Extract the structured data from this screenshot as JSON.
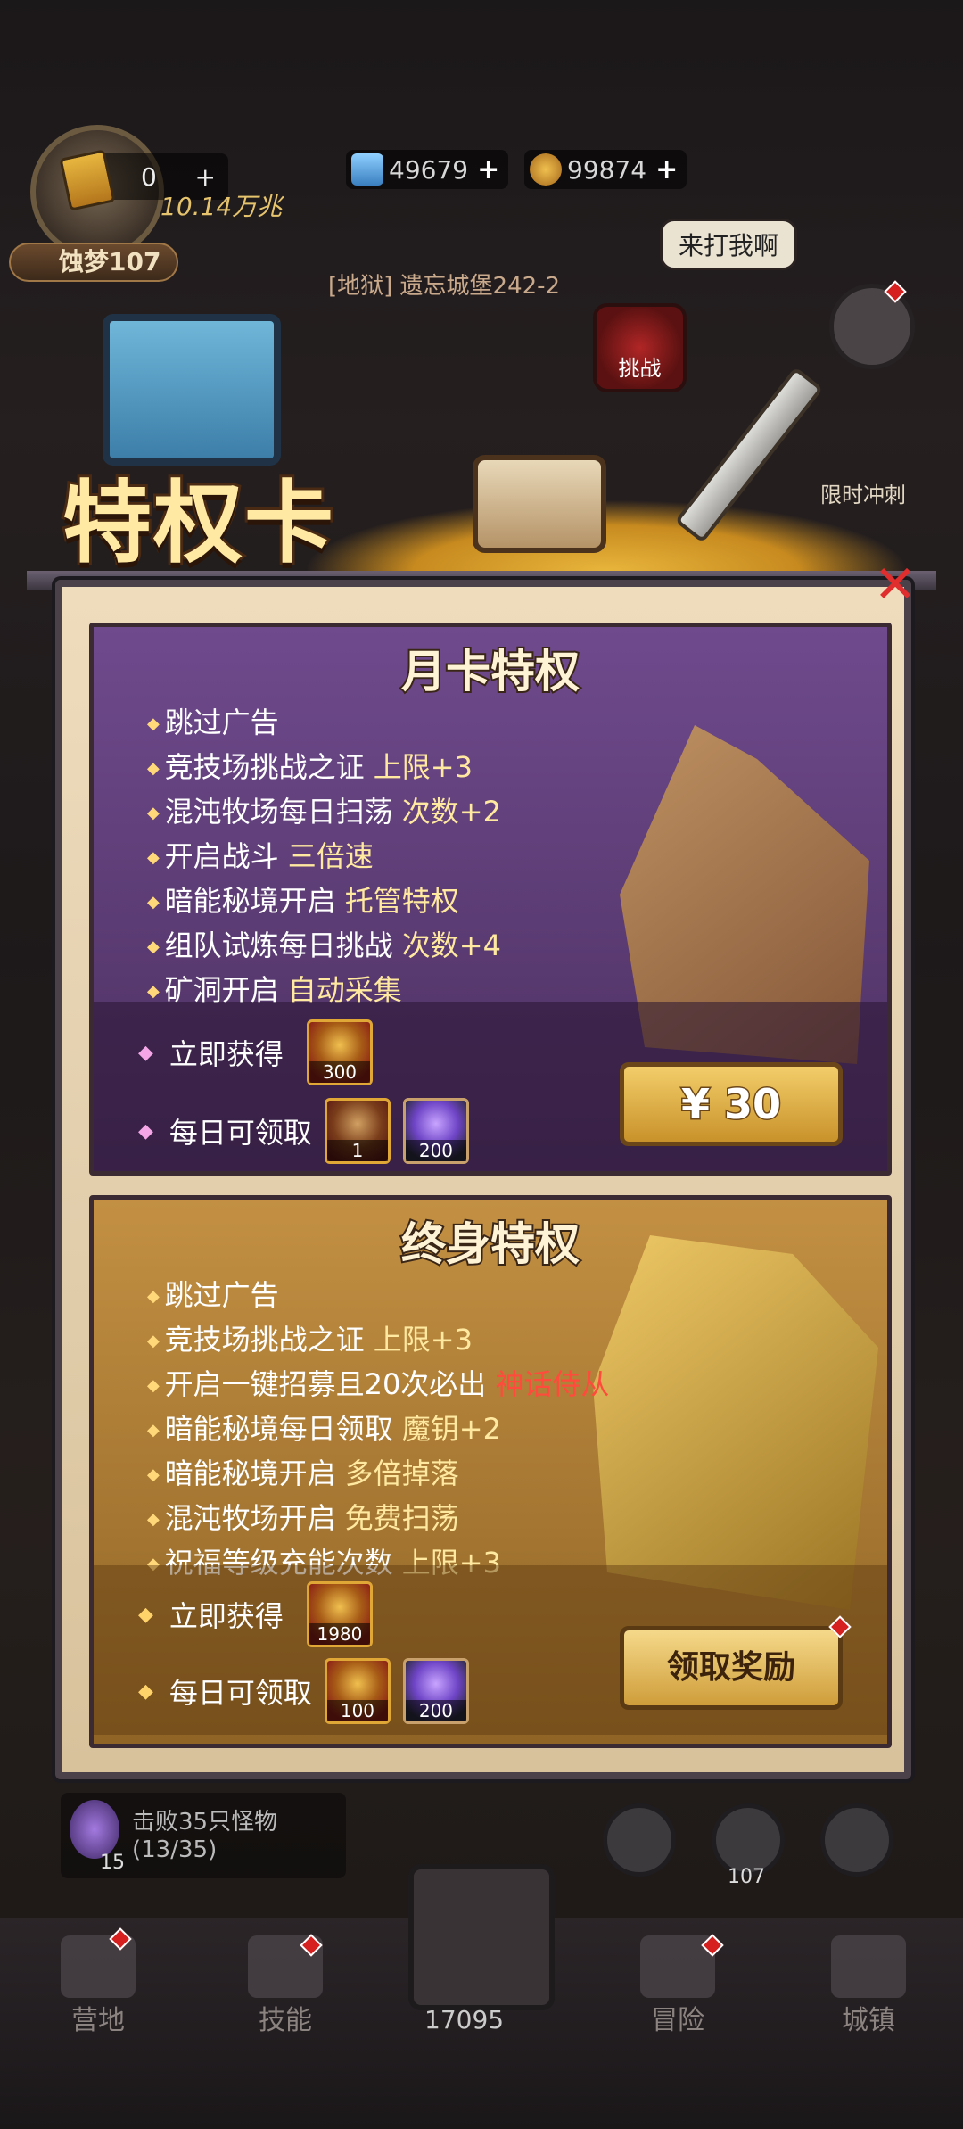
{
  "hud": {
    "ticket_count": "0",
    "power": "10.14万兆",
    "dream_badge": "蚀梦107",
    "diamonds": "49679",
    "gold": "99874",
    "speech": "来打我啊",
    "stage": "[地狱] 遗忘城堡242-2",
    "challenge_label": "挑战",
    "timed_label": "限时冲刺"
  },
  "banner": {
    "title": "特权卡"
  },
  "monthly": {
    "title": "月卡特权",
    "perks": [
      {
        "text": "跳过广告",
        "hl": ""
      },
      {
        "text": "竞技场挑战之证 ",
        "hl": "上限+3"
      },
      {
        "text": "混沌牧场每日扫荡 ",
        "hl": "次数+2"
      },
      {
        "text": "开启战斗 ",
        "hl": "三倍速"
      },
      {
        "text": "暗能秘境开启 ",
        "hl": "托管特权"
      },
      {
        "text": "组队试炼每日挑战 ",
        "hl": "次数+4"
      },
      {
        "text": "矿洞开启 ",
        "hl": "自动采集"
      }
    ],
    "instant_label": "立即获得",
    "instant_items": [
      {
        "icon": "gold-skull-coin-icon",
        "count": "300"
      }
    ],
    "daily_label": "每日可领取",
    "daily_items": [
      {
        "icon": "axe-icon",
        "count": "1"
      },
      {
        "icon": "purple-flame-icon",
        "count": "200"
      }
    ],
    "price": "¥ 30"
  },
  "lifetime": {
    "title": "终身特权",
    "perks": [
      {
        "text": "跳过广告",
        "hl": "",
        "red": ""
      },
      {
        "text": "竞技场挑战之证 ",
        "hl": "上限+3",
        "red": ""
      },
      {
        "text": "开启一键招募且20次必出 ",
        "hl": "",
        "red": "神话侍从"
      },
      {
        "text": "暗能秘境每日领取 ",
        "hl": "魔钥+2",
        "red": ""
      },
      {
        "text": "暗能秘境开启 ",
        "hl": "多倍掉落",
        "red": ""
      },
      {
        "text": "混沌牧场开启 ",
        "hl": "免费扫荡",
        "red": ""
      },
      {
        "text": "祝福等级充能次数 ",
        "hl": "上限+3",
        "red": ""
      }
    ],
    "instant_label": "立即获得",
    "instant_items": [
      {
        "icon": "gold-skull-coin-icon",
        "count": "1980"
      }
    ],
    "daily_label": "每日可领取",
    "daily_items": [
      {
        "icon": "gold-skull-coin-icon",
        "count": "100"
      },
      {
        "icon": "purple-flame-icon",
        "count": "200"
      }
    ],
    "claim_label": "领取奖励"
  },
  "quest": {
    "text": "击败35只怪物",
    "progress": "(13/35)",
    "count": "15"
  },
  "side_counter": "107",
  "nav": {
    "camp": "营地",
    "skills": "技能",
    "center_count": "17095",
    "adventure": "冒险",
    "town": "城镇"
  },
  "colors": {
    "accent_gold": "#f2cd6a",
    "monthly_bg": "#6f4a8d",
    "lifetime_bg": "#c39043",
    "highlight_red": "#ff4b3b"
  }
}
